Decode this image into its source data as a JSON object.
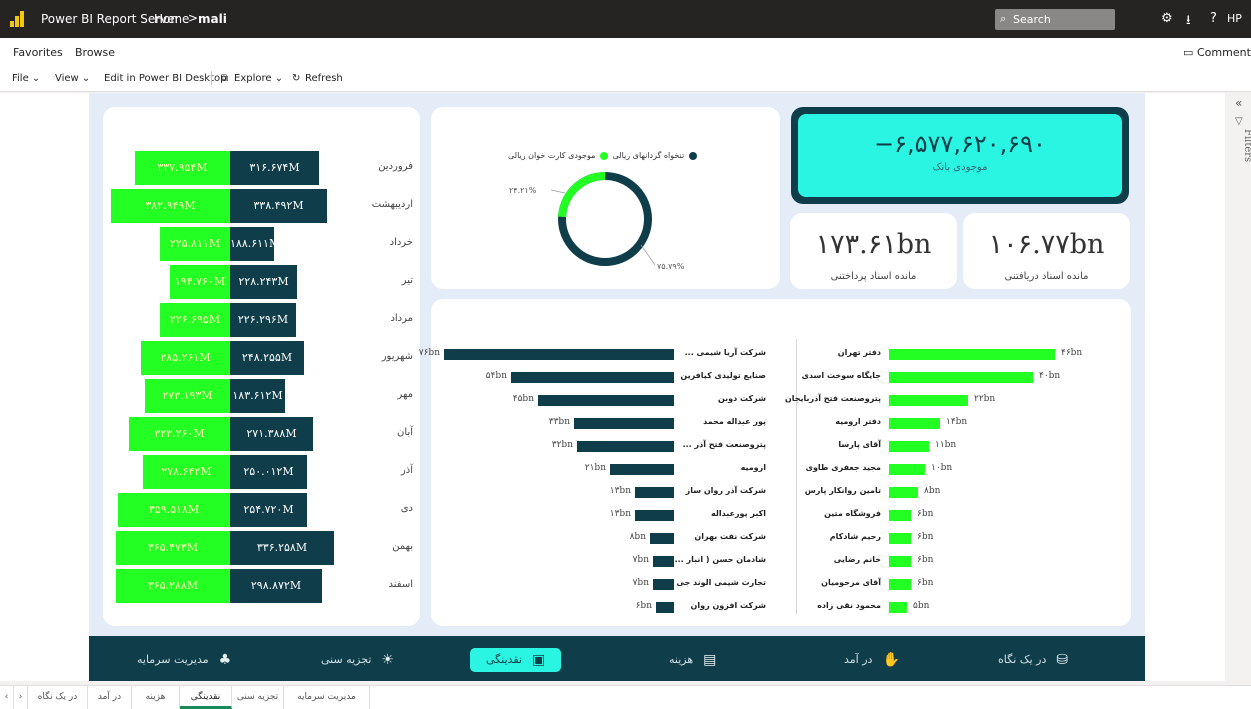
{
  "header": {
    "app_title": "Power BI Report Server",
    "home": "Home",
    "current": "mali",
    "search_placeholder": "Search",
    "help": "?",
    "user": "HP"
  },
  "nav": {
    "favorites": "Favorites",
    "browse": "Browse",
    "comments": "Comments"
  },
  "toolbar": {
    "file": "File ⌄",
    "view": "View ⌄",
    "edit": "Edit in Power BI Desktop",
    "explore": "Explore ⌄",
    "refresh": "Refresh"
  },
  "monthly": [
    {
      "month": "فروردین",
      "received": "۳۳۷.۹۵۴M",
      "paid": "۳۱۶.۶۷۴M",
      "rf": 0.77,
      "pf": 0.74
    },
    {
      "month": "اردیبهشت",
      "received": "۳۸۲.۹۴۹M",
      "paid": "۳۳۸.۴۹۲M",
      "rf": 0.97,
      "pf": 0.81
    },
    {
      "month": "خرداد",
      "received": "۲۲۵.۸۱۱M",
      "paid": "۱۸۸.۶۱۱M",
      "rf": 0.57,
      "pf": 0.37
    },
    {
      "month": "تیر",
      "received": "۱۹۴.۷۶۰M",
      "paid": "۲۲۸.۲۴۳M",
      "rf": 0.49,
      "pf": 0.56
    },
    {
      "month": "مرداد",
      "received": "۲۲۶.۶۹۵M",
      "paid": "۲۲۶.۲۹۶M",
      "rf": 0.57,
      "pf": 0.55
    },
    {
      "month": "شهریور",
      "received": "۲۸۵.۲۶۱M",
      "paid": "۲۴۸.۲۵۵M",
      "rf": 0.72,
      "pf": 0.62
    },
    {
      "month": "مهر",
      "received": "۲۷۳.۱۹۳M",
      "paid": "۱۸۳.۶۱۲M",
      "rf": 0.69,
      "pf": 0.46
    },
    {
      "month": "آبان",
      "received": "۳۲۳.۲۶۰M",
      "paid": "۲۷۱.۳۸۸M",
      "rf": 0.82,
      "pf": 0.69
    },
    {
      "month": "آذر",
      "received": "۲۷۸.۶۴۲M",
      "paid": "۲۵۰.۰۱۲M",
      "rf": 0.71,
      "pf": 0.64
    },
    {
      "month": "دی",
      "received": "۳۵۹.۵۱۸M",
      "paid": "۲۵۴.۷۲۰M",
      "rf": 0.91,
      "pf": 0.64
    },
    {
      "month": "بهمن",
      "received": "۳۶۵.۴۷۳M",
      "paid": "۳۳۶.۲۵۸M",
      "rf": 0.93,
      "pf": 0.87
    },
    {
      "month": "اسفند",
      "received": "۳۶۵.۲۸۸M",
      "paid": "۲۹۸.۸۷۲M",
      "rf": 0.93,
      "pf": 0.77
    }
  ],
  "donut": {
    "legend": [
      "تنخواه گردانهای ریالی",
      "موجودی کارت خوان ریالی"
    ],
    "colors": [
      "#0f3d4a",
      "#23ff23"
    ],
    "pct_green": "۲۴.۲۱%",
    "pct_dark": "۷۵.۷۹%",
    "green_fraction": 0.2421
  },
  "bank": {
    "value": "−۶,۵۷۷,۶۲۰,۶۹۰",
    "label": "موجودی بانک"
  },
  "payable": {
    "value": "۱۷۳.۶۱bn",
    "label": "مانده اسناد پرداختنی"
  },
  "receivable": {
    "value": "۱۰۶.۷۷bn",
    "label": "مانده اسناد دریافتنی"
  },
  "payables": [
    {
      "name": "... شرکت آریا شیمی",
      "value": "۷۶bn",
      "amount": 76
    },
    {
      "name": "صنایع تولیدی کیافرین",
      "value": "۵۴bn",
      "amount": 54
    },
    {
      "name": "شرکت دوبن",
      "value": "۴۵bn",
      "amount": 45
    },
    {
      "name": "پور عبداله محمد",
      "value": "۳۳bn",
      "amount": 33
    },
    {
      "name": "... پتروصنعت فتح آذر",
      "value": "۳۲bn",
      "amount": 32
    },
    {
      "name": "ارومیه",
      "value": "۲۱bn",
      "amount": 21
    },
    {
      "name": "شرکت آذر روان ساز",
      "value": "۱۳bn",
      "amount": 13
    },
    {
      "name": "اکبر پورعبداله",
      "value": "۱۳bn",
      "amount": 13
    },
    {
      "name": "شرکت نفت بهران",
      "value": "۸bn",
      "amount": 8
    },
    {
      "name": "... شادمان حسن ( انبار",
      "value": "۷bn",
      "amount": 7
    },
    {
      "name": "تجارت شیمی الوند جی",
      "value": "۷bn",
      "amount": 7
    },
    {
      "name": "شرکت افزون روان",
      "value": "۶bn",
      "amount": 6
    }
  ],
  "receivables": [
    {
      "name": "دفتر تهران",
      "value": "۴۶bn",
      "amount": 46
    },
    {
      "name": "جایگاه سوخت اسدی",
      "value": "۴۰bn",
      "amount": 40
    },
    {
      "name": "پتروصنعت فتح آذربایجان",
      "value": "۲۲bn",
      "amount": 22
    },
    {
      "name": "دفتر ارومیه",
      "value": "۱۴bn",
      "amount": 14
    },
    {
      "name": "آقای پارسا",
      "value": "۱۱bn",
      "amount": 11
    },
    {
      "name": "مجید جعفری طاوی",
      "value": "۱۰bn",
      "amount": 10
    },
    {
      "name": "تامین روانکار پارس",
      "value": "۸bn",
      "amount": 8
    },
    {
      "name": "فروشگاه متین",
      "value": "۶bn",
      "amount": 6
    },
    {
      "name": "رحیم شادکام",
      "value": "۶bn",
      "amount": 6
    },
    {
      "name": "خانم رضایی",
      "value": "۶bn",
      "amount": 6
    },
    {
      "name": "آقای مرحومیان",
      "value": "۶bn",
      "amount": 6
    },
    {
      "name": "محمود نقی زاده",
      "value": "۵bn",
      "amount": 5
    }
  ],
  "bottom_nav": [
    "در یک نگاه",
    "در آمد",
    "هزینه",
    "نقدینگی",
    "تجزیه سنی",
    "مدیریت سرمایه"
  ],
  "page_tabs": [
    "در یک نگاه",
    "در آمد",
    "هزینه",
    "نقدینگی",
    "تجزیه سنی",
    "مدیریت سرمایه"
  ],
  "filters_label": "Filters"
}
